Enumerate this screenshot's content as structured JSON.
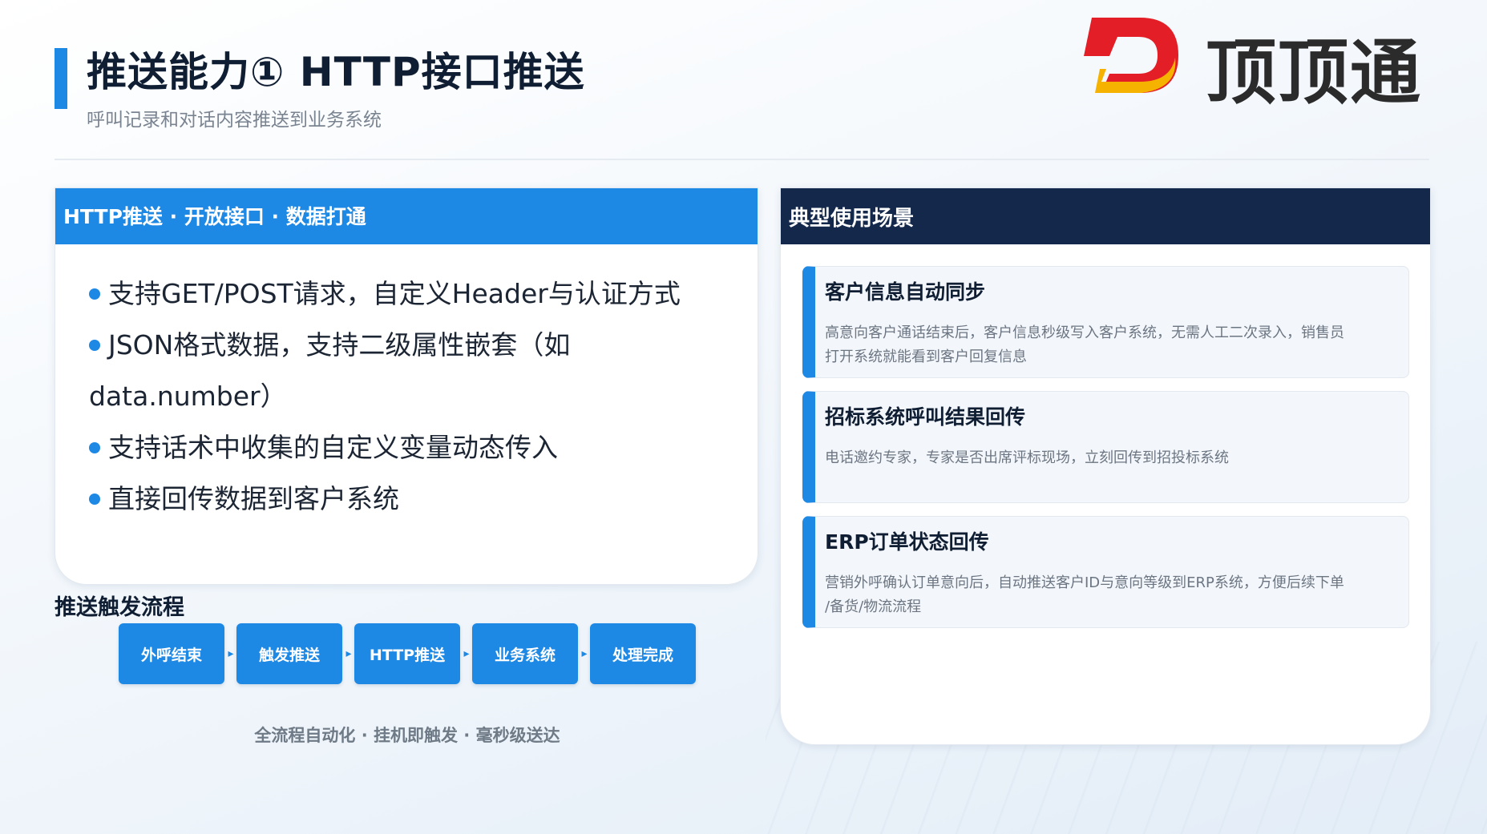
{
  "header": {
    "title": "推送能力① HTTP接口推送",
    "subtitle": "呼叫记录和对话内容推送到业务系统"
  },
  "logo": {
    "text": "顶顶通",
    "colors": {
      "red": "#e41e26",
      "yellow": "#f5b300",
      "text": "#2b2b2b"
    }
  },
  "left_panel": {
    "header": "HTTP推送 · 开放接口 · 数据打通",
    "bullets": [
      "支持GET/POST请求，自定义Header与认证方式",
      "JSON格式数据，支持二级属性嵌套（如",
      "data.number）",
      "支持话术中收集的自定义变量动态传入",
      "直接回传数据到客户系统"
    ]
  },
  "flow": {
    "title": "推送触发流程",
    "steps": [
      "外呼结束",
      "触发推送",
      "HTTP推送",
      "业务系统",
      "处理完成"
    ],
    "caption": "全流程自动化 · 挂机即触发 · 毫秒级送达"
  },
  "right_panel": {
    "header": "典型使用场景",
    "scenarios": [
      {
        "title": "客户信息自动同步",
        "desc_line1": "高意向客户通话结束后，客户信息秒级写入客户系统，无需人工二次录入，销售员",
        "desc_line2": "打开系统就能看到客户回复信息"
      },
      {
        "title": "招标系统呼叫结果回传",
        "desc_line1": "电话邀约专家，专家是否出席评标现场，立刻回传到招投标系统",
        "desc_line2": ""
      },
      {
        "title": "ERP订单状态回传",
        "desc_line1": "营销外呼确认订单意向后，自动推送客户ID与意向等级到ERP系统，方便后续下单",
        "desc_line2": "/备货/物流流程"
      }
    ]
  },
  "colors": {
    "accent_blue": "#1e88e5",
    "navy": "#13284a"
  }
}
